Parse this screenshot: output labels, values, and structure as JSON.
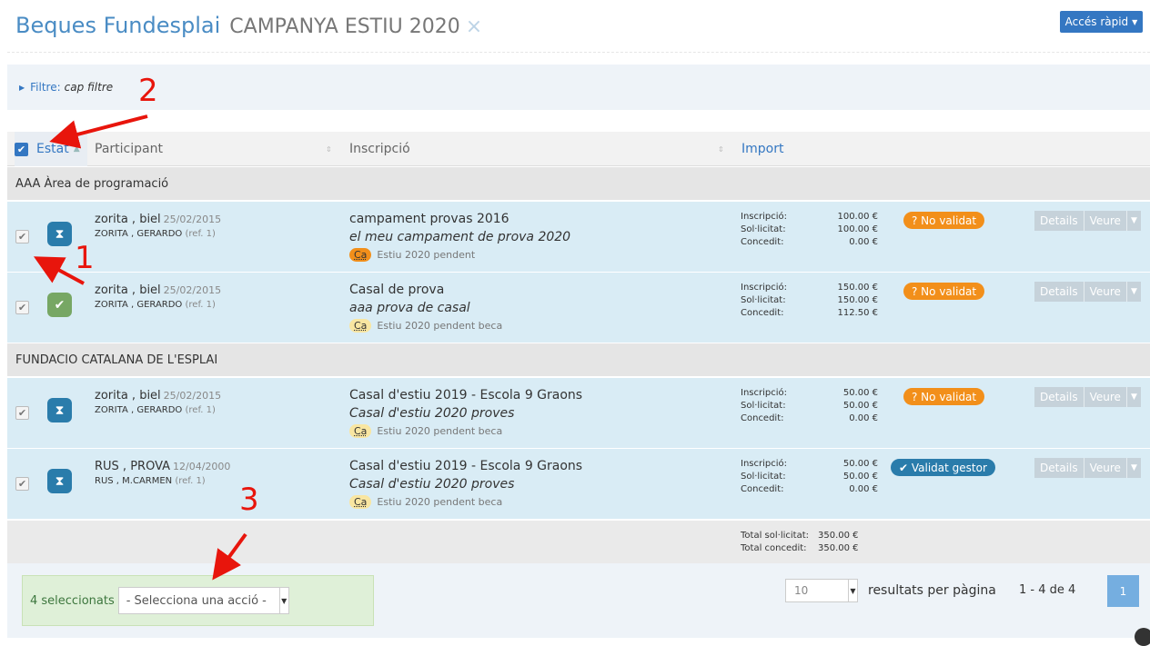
{
  "header": {
    "title": "Beques Fundesplai",
    "campaign": "Campanya Estiu 2020",
    "close_icon": "×",
    "quick_access": "Accés ràpid"
  },
  "filter": {
    "label": "Filtre:",
    "value": "cap filtre"
  },
  "columns": {
    "estat": "Estat",
    "participant": "Participant",
    "inscripcio": "Inscripció",
    "import": "Import"
  },
  "groups": [
    "AAA Àrea de programació",
    "FUNDACIO CATALANA DE L'ESPLAI"
  ],
  "amount_labels": {
    "inscripcio": "Inscripció:",
    "sollicitat": "Sol·licitat:",
    "concedit": "Concedit:"
  },
  "rows": [
    {
      "status": "pending",
      "name": "zorita , biel",
      "dob": "25/02/2015",
      "parent": "ZORITA , GERARDO",
      "ref": "(ref. 1)",
      "course": "campament provas 2016",
      "desc": "el meu campament de prova 2020",
      "chip": "Ca",
      "chip_color": "orange",
      "chip_text": "Estiu 2020 pendent",
      "inscripcio": "100.00 €",
      "sollicitat": "100.00 €",
      "concedit": "0.00 €",
      "badge": "? No validat",
      "badge_type": "warning"
    },
    {
      "status": "ok",
      "name": "zorita , biel",
      "dob": "25/02/2015",
      "parent": "ZORITA , GERARDO",
      "ref": "(ref. 1)",
      "course": "Casal de prova",
      "desc": "aaa prova de casal",
      "chip": "Ca",
      "chip_color": "yellow",
      "chip_text": "Estiu 2020 pendent beca",
      "inscripcio": "150.00 €",
      "sollicitat": "150.00 €",
      "concedit": "112.50 €",
      "badge": "? No validat",
      "badge_type": "warning"
    },
    {
      "status": "pending",
      "name": "zorita , biel",
      "dob": "25/02/2015",
      "parent": "ZORITA , GERARDO",
      "ref": "(ref. 1)",
      "course": "Casal d'estiu 2019 - Escola 9 Graons",
      "desc": "Casal d'estiu 2020 proves",
      "chip": "Ca",
      "chip_color": "yellow",
      "chip_text": "Estiu 2020 pendent beca",
      "inscripcio": "50.00 €",
      "sollicitat": "50.00 €",
      "concedit": "0.00 €",
      "badge": "? No validat",
      "badge_type": "warning"
    },
    {
      "status": "pending",
      "name": "RUS , PROVA",
      "dob": "12/04/2000",
      "parent": "RUS , M.CARMEN",
      "ref": "(ref. 1)",
      "course": "Casal d'estiu 2019 - Escola 9 Graons",
      "desc": "Casal d'estiu 2020 proves",
      "chip": "Ca",
      "chip_color": "yellow",
      "chip_text": "Estiu 2020 pendent beca",
      "inscripcio": "50.00 €",
      "sollicitat": "50.00 €",
      "concedit": "0.00 €",
      "badge": "✔ Validat gestor",
      "badge_type": "info"
    }
  ],
  "row_actions": {
    "details": "Details",
    "veure": "Veure"
  },
  "totals": {
    "sollicitat_label": "Total sol·licitat:",
    "sollicitat": "350.00 €",
    "concedit_label": "Total concedit:",
    "concedit": "350.00 €"
  },
  "footer": {
    "selected": "4 seleccionats",
    "action_placeholder": "- Selecciona una acció -",
    "per_page": "10",
    "per_page_label": "resultats per pàgina",
    "range": "1 - 4 de 4",
    "page": "1"
  },
  "annotations": [
    "2",
    "1",
    "3"
  ],
  "colors": {
    "accent": "#3477c2",
    "warning": "#f28f1a",
    "info": "#2a7cab",
    "row_bg": "#d9ecf5",
    "annotation": "#e8150c"
  }
}
